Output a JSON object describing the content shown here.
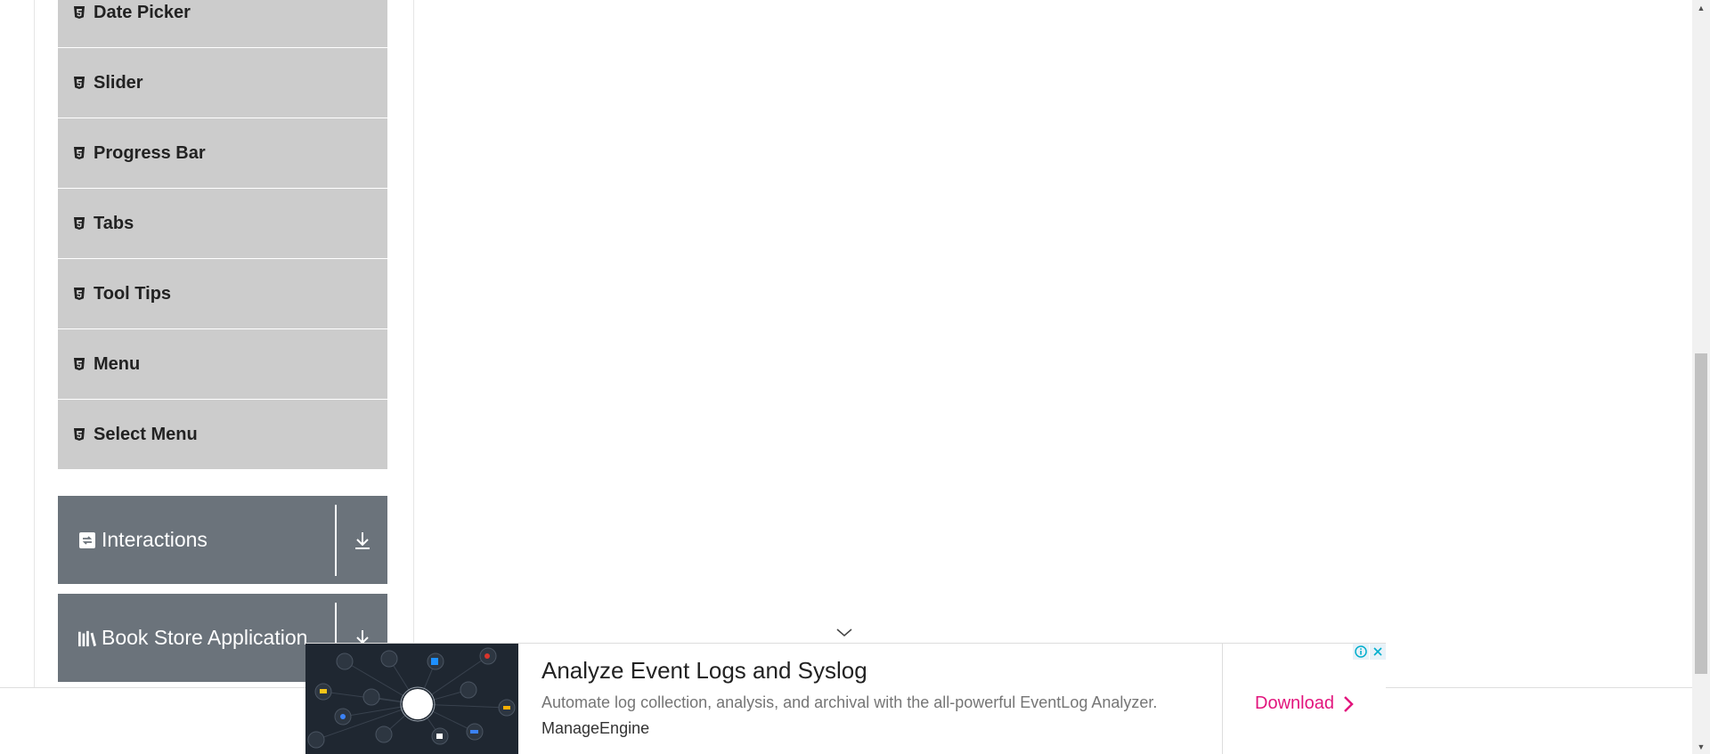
{
  "sidebar": {
    "items": [
      {
        "label": "Date Picker"
      },
      {
        "label": "Slider"
      },
      {
        "label": "Progress Bar"
      },
      {
        "label": "Tabs"
      },
      {
        "label": "Tool Tips"
      },
      {
        "label": "Menu"
      },
      {
        "label": "Select Menu"
      }
    ],
    "groups": [
      {
        "label": "Interactions",
        "icon": "interactions-icon"
      },
      {
        "label": "Book Store Application",
        "icon": "book-store-icon"
      }
    ]
  },
  "ad": {
    "title": "Analyze Event Logs and Syslog",
    "description": "Automate log collection, analysis, and archival with the all-powerful EventLog Analyzer.",
    "brand": "ManageEngine",
    "cta_label": "Download",
    "cta_color": "#e2157d"
  },
  "colors": {
    "menu_item_bg": "#cccccc",
    "group_bg": "#6b737b"
  }
}
